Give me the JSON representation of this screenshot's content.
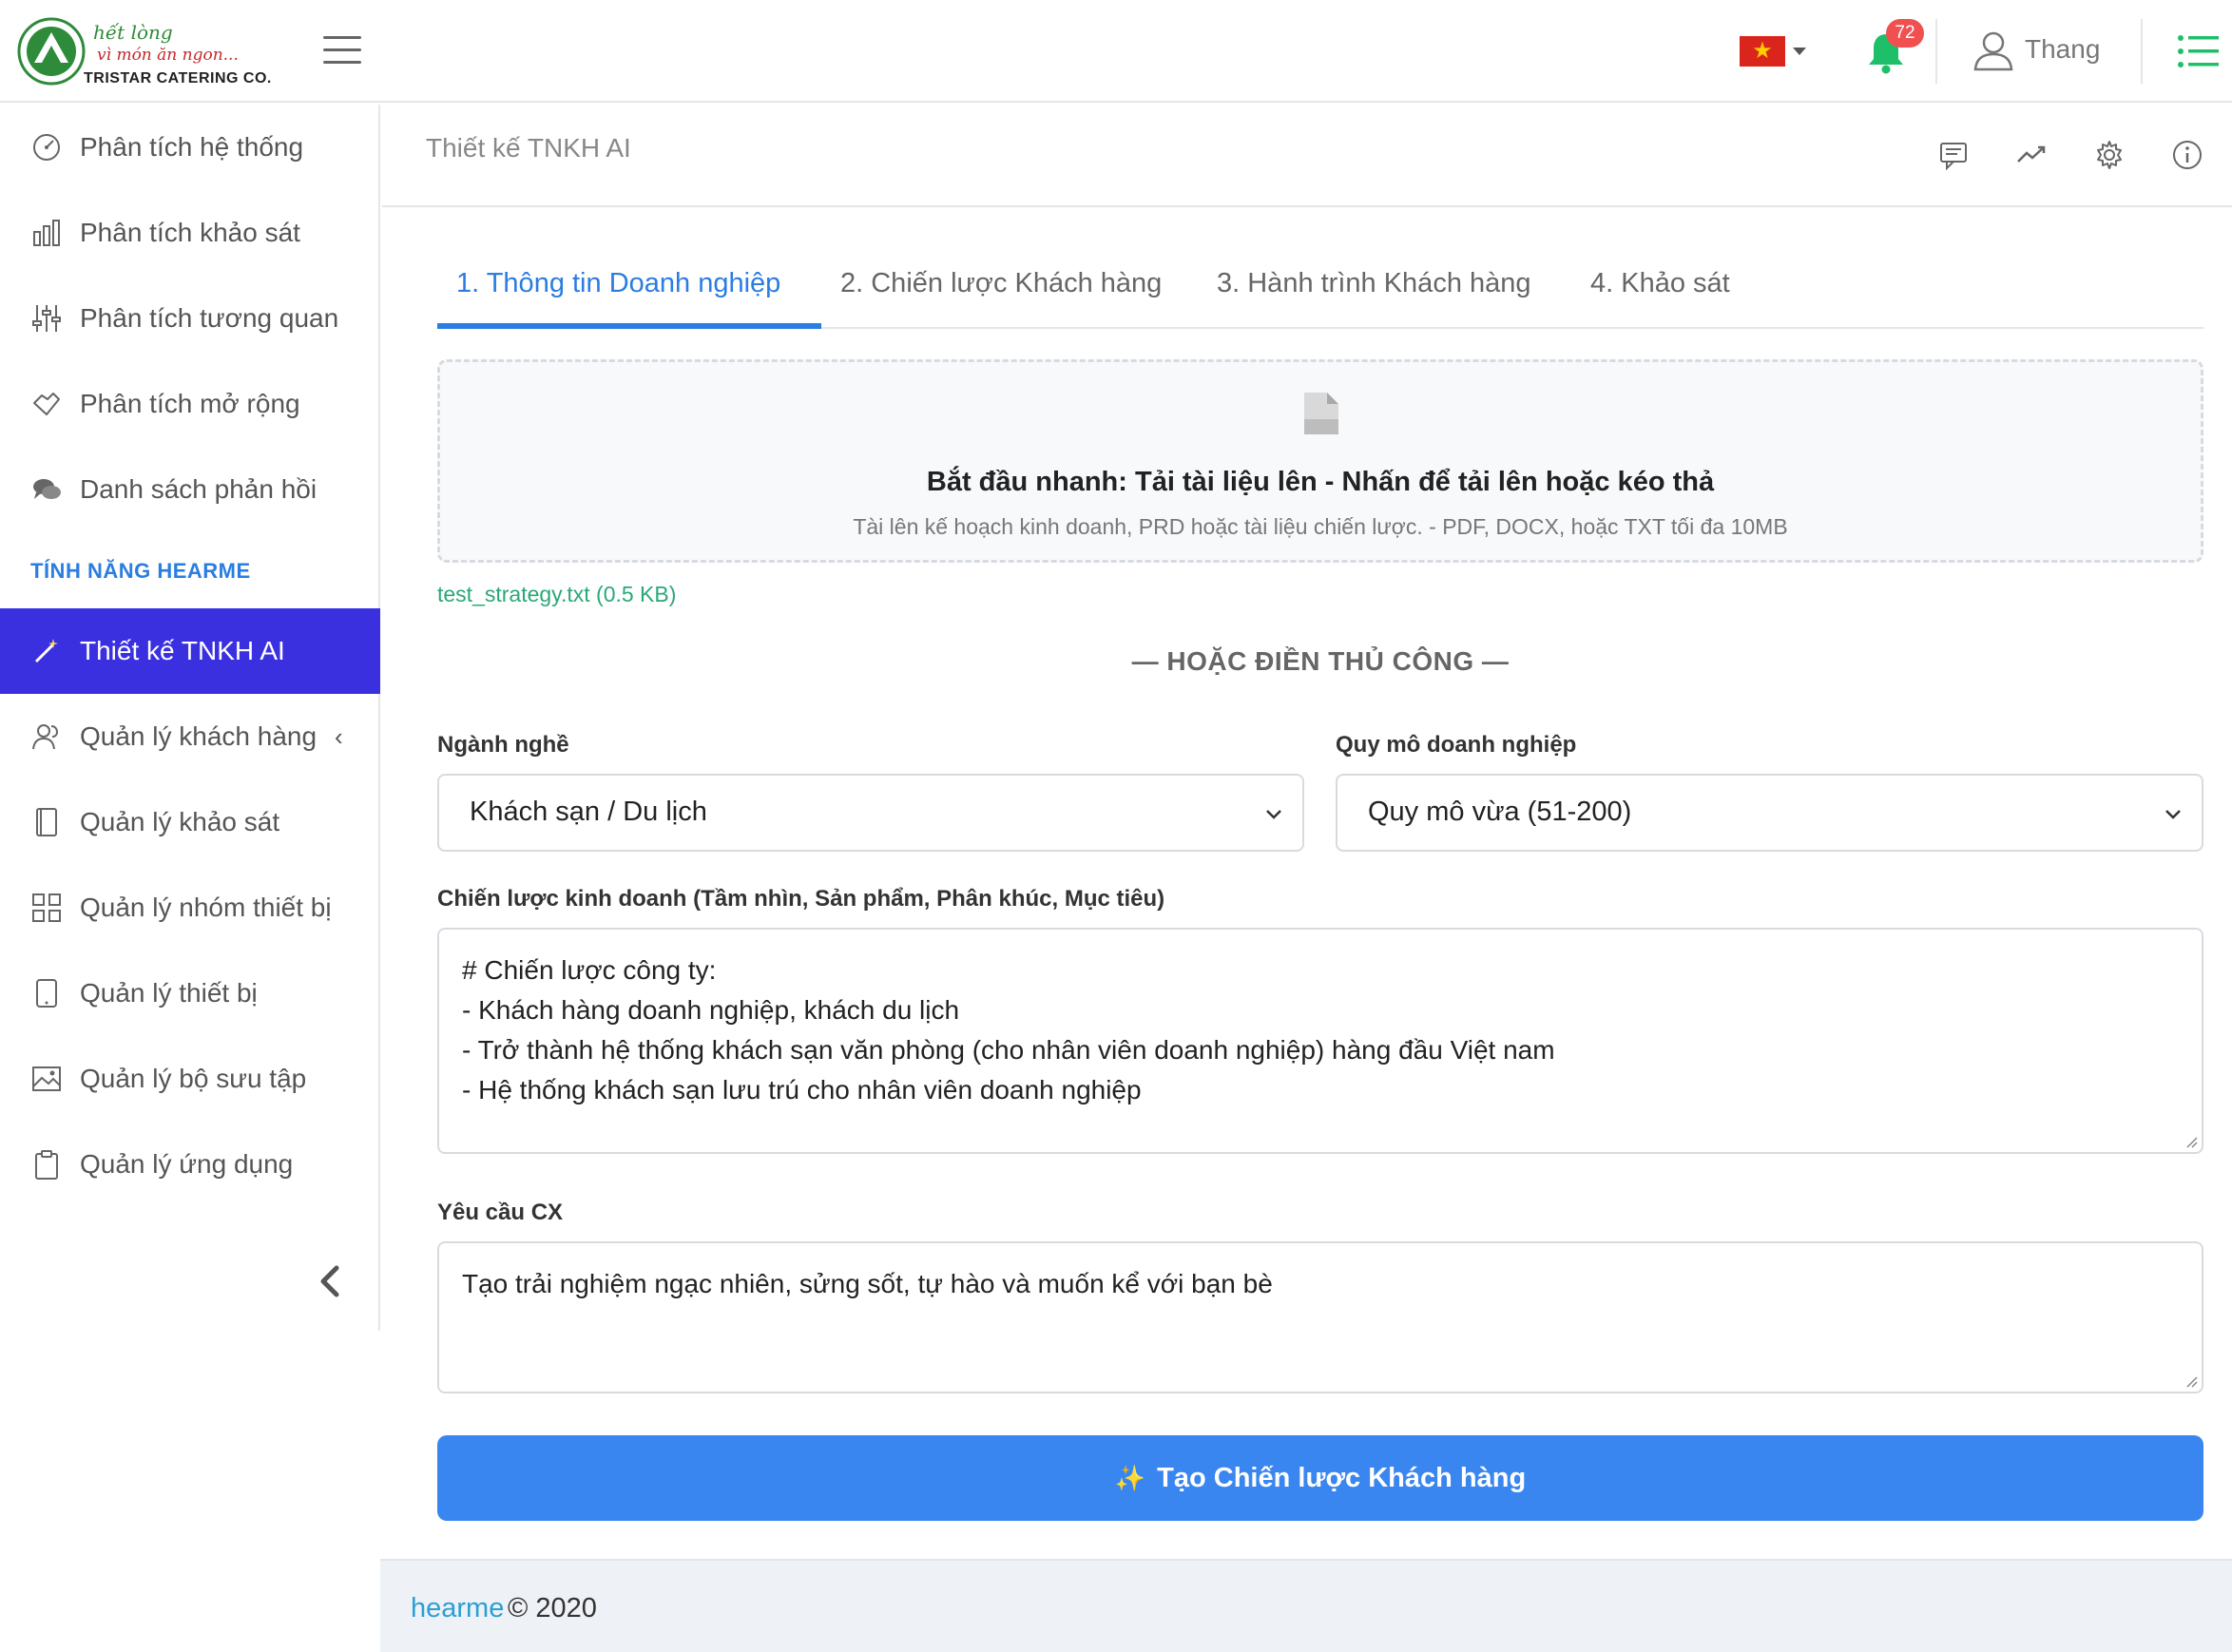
{
  "header": {
    "logo_script_1": "hết lòng",
    "logo_script_2": "vì món ăn ngon...",
    "logo_company": "TRISTAR CATERING CO.",
    "notification_count": "72",
    "user_name": "Thang"
  },
  "sidebar": {
    "items_top": [
      {
        "label": "Phân tích hệ thống",
        "icon": "gauge-icon"
      },
      {
        "label": "Phân tích khảo sát",
        "icon": "bar-chart-icon"
      },
      {
        "label": "Phân tích tương quan",
        "icon": "sliders-icon"
      },
      {
        "label": "Phân tích mở rộng",
        "icon": "handshake-icon"
      },
      {
        "label": "Danh sách phản hồi",
        "icon": "chat-icon"
      }
    ],
    "section_title": "TÍNH NĂNG HEARME",
    "items_bottom": [
      {
        "label": "Thiết kế TNKH AI",
        "icon": "magic-wand-icon",
        "active": true
      },
      {
        "label": "Quản lý khách hàng",
        "icon": "users-icon"
      },
      {
        "label": "Quản lý khảo sát",
        "icon": "notebook-icon"
      },
      {
        "label": "Quản lý nhóm thiết bị",
        "icon": "grid-icon"
      },
      {
        "label": "Quản lý thiết bị",
        "icon": "tablet-icon"
      },
      {
        "label": "Quản lý bộ sưu tập",
        "icon": "image-icon"
      },
      {
        "label": "Quản lý ứng dụng",
        "icon": "clipboard-icon"
      }
    ]
  },
  "page": {
    "title": "Thiết kế TNKH AI"
  },
  "tabs": [
    {
      "label": "1. Thông tin Doanh nghiệp",
      "active": true
    },
    {
      "label": "2. Chiến lược Khách hàng"
    },
    {
      "label": "3. Hành trình Khách hàng"
    },
    {
      "label": "4. Khảo sát"
    }
  ],
  "upload": {
    "title": "Bắt đầu nhanh: Tải tài liệu lên - Nhấn để tải lên hoặc kéo thả",
    "subtitle": "Tài lên kế hoạch kinh doanh, PRD hoặc tài liệu chiến lược. - PDF, DOCX, hoặc TXT tối đa 10MB",
    "file_name": "test_strategy.txt (0.5 KB)"
  },
  "or_divider": "— HOẶC ĐIỀN THỦ CÔNG —",
  "form": {
    "industry_label": "Ngành nghề",
    "industry_value": "Khách sạn / Du lịch",
    "scale_label": "Quy mô doanh nghiệp",
    "scale_value": "Quy mô vừa (51-200)",
    "strategy_label": "Chiến lược kinh doanh (Tầm nhìn, Sản phẩm, Phân khúc, Mục tiêu)",
    "strategy_lines": [
      "# Chiến lược công ty:",
      "- Khách hàng doanh nghiệp, khách du lịch",
      "- Trở thành hệ thống khách sạn văn phòng (cho nhân viên doanh nghiệp) hàng đầu Việt nam",
      "- Hệ thống khách sạn lưu trú cho nhân viên doanh nghiệp"
    ],
    "cx_label": "Yêu cầu CX",
    "cx_value": "Tạo trải nghiệm ngạc nhiên, sửng sốt, tự hào và muốn kể với bạn bè",
    "submit_icon": "✨",
    "submit_label": "Tạo Chiến lược Khách hàng"
  },
  "footer": {
    "brand": "hearme",
    "rest": "© 2020"
  },
  "colors": {
    "accent": "#2a7de1",
    "sidebar_active": "#3b30e0",
    "primary_button": "#3a86f0",
    "badge": "#f05050",
    "bell": "#1fbf6a",
    "file_name": "#2aa876"
  }
}
